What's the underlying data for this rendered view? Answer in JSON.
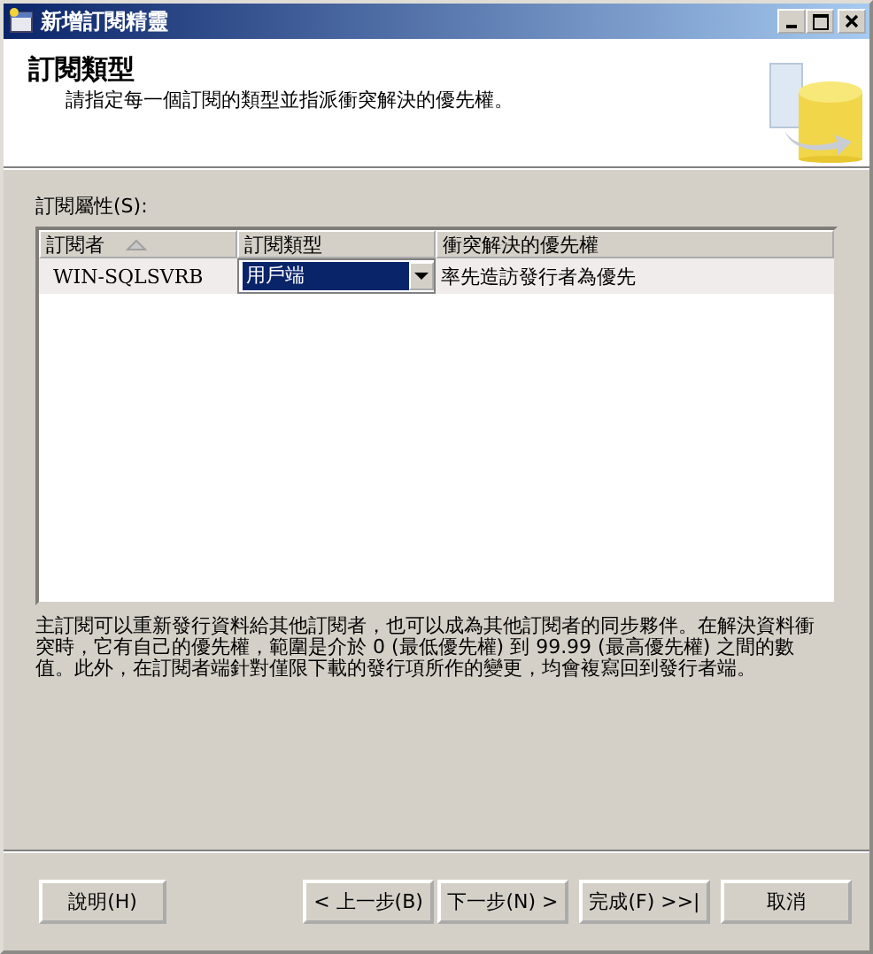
{
  "window": {
    "title": "新增訂閱精靈"
  },
  "header": {
    "title": "訂閱類型",
    "subtitle": "請指定每一個訂閱的類型並指派衝突解決的優先權。"
  },
  "grid_label": "訂閱屬性(S):",
  "table": {
    "columns": [
      {
        "label": "訂閱者",
        "sorted": true
      },
      {
        "label": "訂閱類型",
        "sorted": false
      },
      {
        "label": "衝突解決的優先權",
        "sorted": false
      }
    ],
    "rows": [
      {
        "subscriber": "WIN-SQLSVRB",
        "type": "用戶端",
        "priority": "率先造訪發行者為優先",
        "selected": true
      }
    ]
  },
  "description": "主訂閱可以重新發行資料給其他訂閱者，也可以成為其他訂閱者的同步夥伴。在解決資料衝突時，它有自己的優先權，範圍是介於 0 (最低優先權) 到 99.99 (最高優先權) 之間的數值。此外，在訂閱者端針對僅限下載的發行項所作的變更，均會複寫回到發行者端。",
  "buttons": [
    {
      "label": "說明(H)",
      "kind": "help"
    },
    {
      "label": "< 上一步(B)",
      "kind": "nav"
    },
    {
      "label": "下一步(N) >",
      "kind": "nav"
    },
    {
      "label": "完成(F) >>|",
      "kind": "nav"
    },
    {
      "label": "取消",
      "kind": "nav"
    }
  ]
}
